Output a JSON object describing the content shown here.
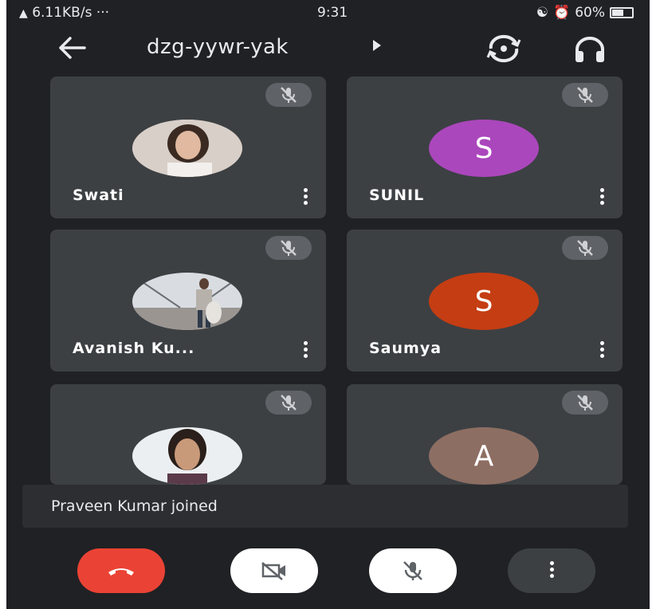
{
  "status_bar": {
    "left_text": "6.11KB/s ···",
    "time": "9:31",
    "battery": "60%",
    "battery_level": 0.6
  },
  "top_bar": {
    "meeting_code": "dzg-yywr-yak",
    "icons": [
      "back-arrow-icon",
      "expand-caret-icon",
      "switch-camera-icon",
      "headphones-icon"
    ]
  },
  "participants": [
    {
      "name": "Swati",
      "avatar_type": "photo",
      "muted": true
    },
    {
      "name": "SUNIL",
      "avatar_type": "initial",
      "initial": "S",
      "avatar_color": "#ab47bc",
      "muted": true
    },
    {
      "name": "Avanish Ku...",
      "avatar_type": "photo",
      "muted": true
    },
    {
      "name": "Saumya",
      "avatar_type": "initial",
      "initial": "S",
      "avatar_color": "#c53d13",
      "muted": true
    },
    {
      "name": "",
      "avatar_type": "photo",
      "muted": true
    },
    {
      "name": "",
      "avatar_type": "initial",
      "initial": "A",
      "avatar_color": "#8d6e63",
      "muted": true
    }
  ],
  "notification": "Praveen Kumar joined",
  "controls": [
    {
      "name": "end-call",
      "icon": "phone-hangup-icon",
      "color": "#ea4335"
    },
    {
      "name": "camera",
      "icon": "camera-off-icon",
      "color": "#ffffff"
    },
    {
      "name": "microphone",
      "icon": "mic-off-icon",
      "color": "#ffffff"
    },
    {
      "name": "more",
      "icon": "more-vert-icon",
      "color": "#3c4043"
    }
  ]
}
